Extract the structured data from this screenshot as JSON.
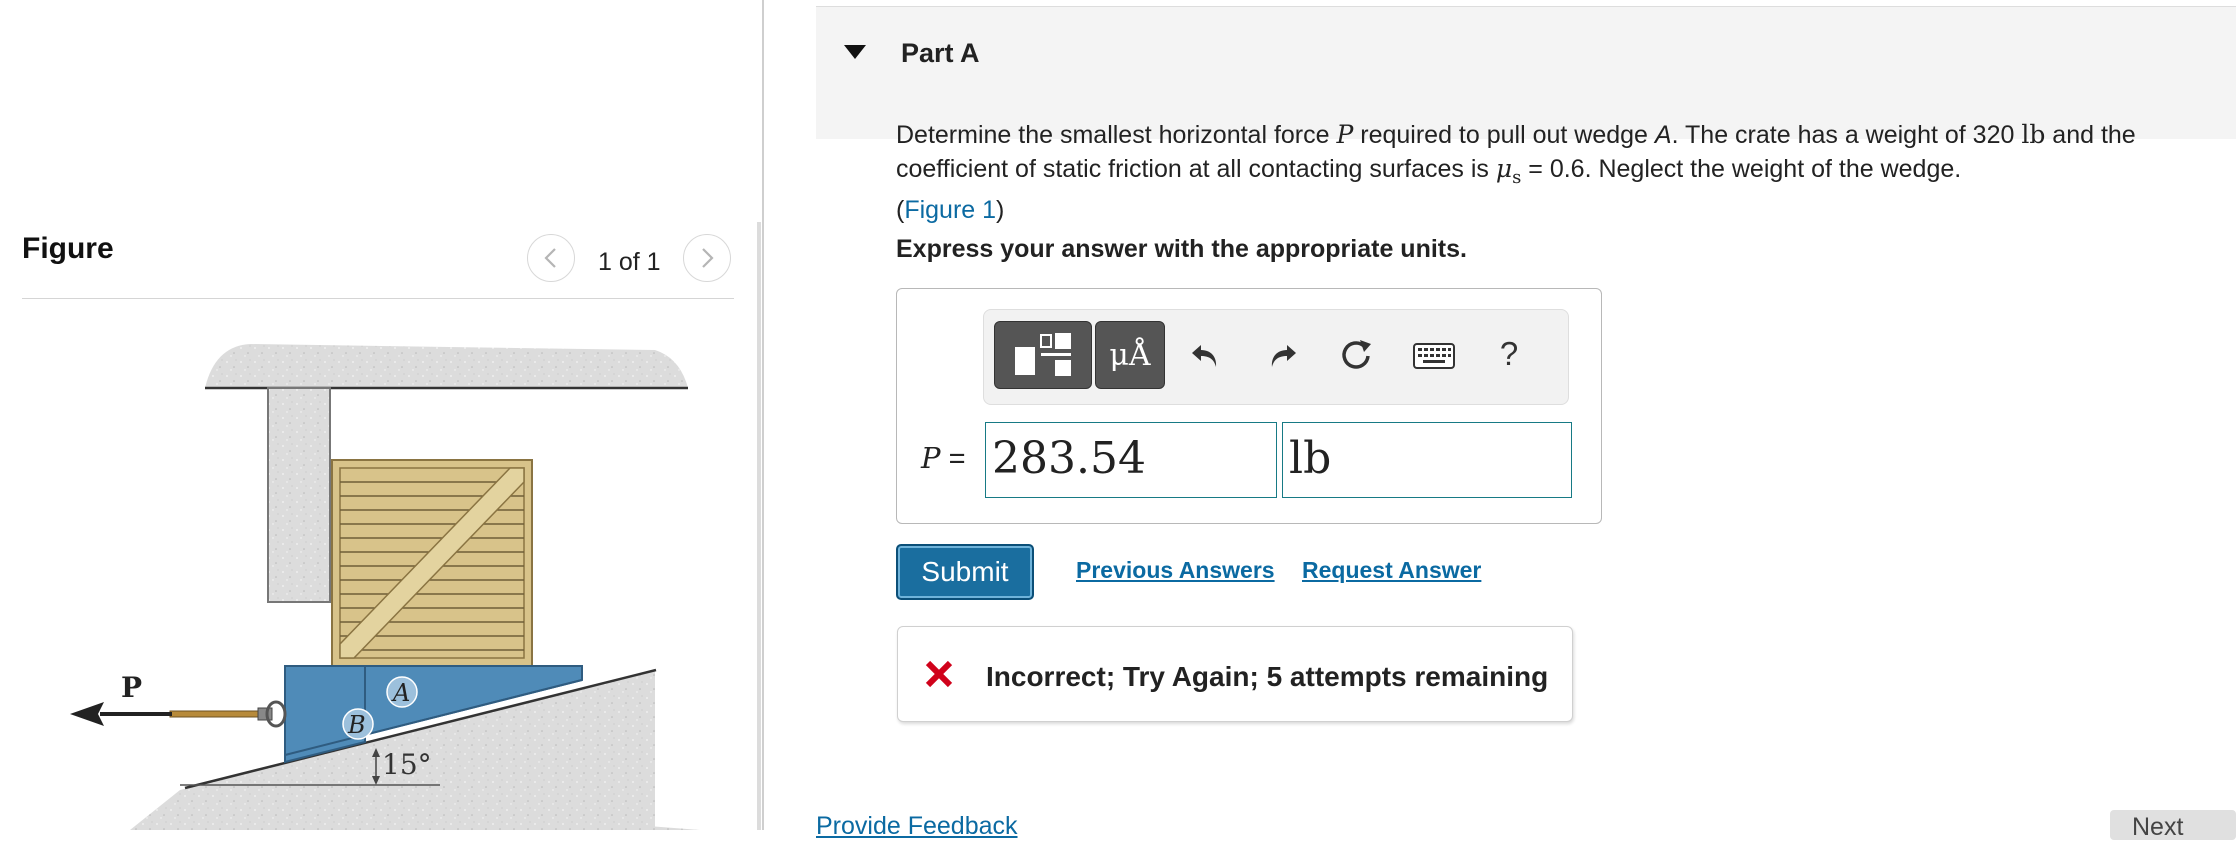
{
  "figure_panel": {
    "title": "Figure",
    "page_counter": "1 of 1",
    "diagram_labels": {
      "force": "P",
      "wedge": "A",
      "block": "B",
      "angle": "15°"
    }
  },
  "part": {
    "title": "Part A",
    "question": {
      "text_before_var": "Determine the smallest horizontal force ",
      "var_P": "P",
      "text_after_var": " required to pull out wedge ",
      "wedge": "A",
      "text_weight": ". The crate has a weight of 320 ",
      "unit_lb": "lb",
      "text_mu": " and the coefficient of static friction at all contacting surfaces is ",
      "mu_symbol": "μ",
      "mu_sub": "s",
      "text_end": " = 0.6. Neglect the weight of the wedge.",
      "figure_link": "Figure 1",
      "paren_open": "(",
      "paren_close": ")"
    },
    "instruction": "Express your answer with the appropriate units."
  },
  "answer": {
    "toolbar": {
      "units_button": "μÅ",
      "help": "?"
    },
    "label_var": "P",
    "label_eq": " =",
    "value": "283.54",
    "unit": "lb"
  },
  "actions": {
    "submit": "Submit",
    "previous_answers": "Previous Answers",
    "request_answer": "Request Answer"
  },
  "feedback": {
    "message": "Incorrect; Try Again; 5 attempts remaining"
  },
  "footer": {
    "provide_feedback": "Provide Feedback",
    "next": "Next"
  },
  "colors": {
    "link": "#0b6aa2",
    "submit": "#1a6e9f",
    "error": "#d0021b",
    "input_border": "#177a85",
    "wedge": "#4f8bb8",
    "crate": "#d8c38a"
  }
}
